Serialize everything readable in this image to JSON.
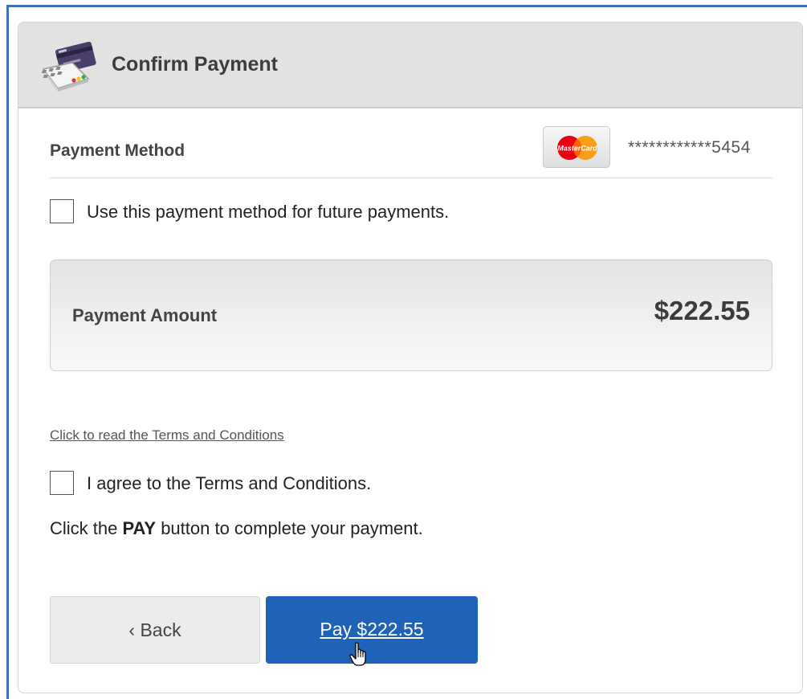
{
  "header": {
    "title": "Confirm Payment",
    "icon": "credit-card-terminal-icon"
  },
  "payment_method": {
    "label": "Payment Method",
    "card_brand": "MasterCard",
    "card_number": "************5454"
  },
  "save_method": {
    "label": "Use this payment method for future payments.",
    "checked": false
  },
  "amount": {
    "label": "Payment Amount",
    "value": "$222.55"
  },
  "terms": {
    "link_text": "Click to read the Terms and Conditions",
    "agree_label": "I agree to the Terms and Conditions.",
    "agree_checked": false
  },
  "instruction": {
    "prefix": "Click the ",
    "keyword": "PAY",
    "suffix": " button to complete your payment."
  },
  "buttons": {
    "back_label": "‹ Back",
    "pay_label": "Pay $222.55"
  },
  "colors": {
    "frame": "#3f70be",
    "pay_button": "#1e63b8",
    "header_bg": "#e2e2e2"
  }
}
